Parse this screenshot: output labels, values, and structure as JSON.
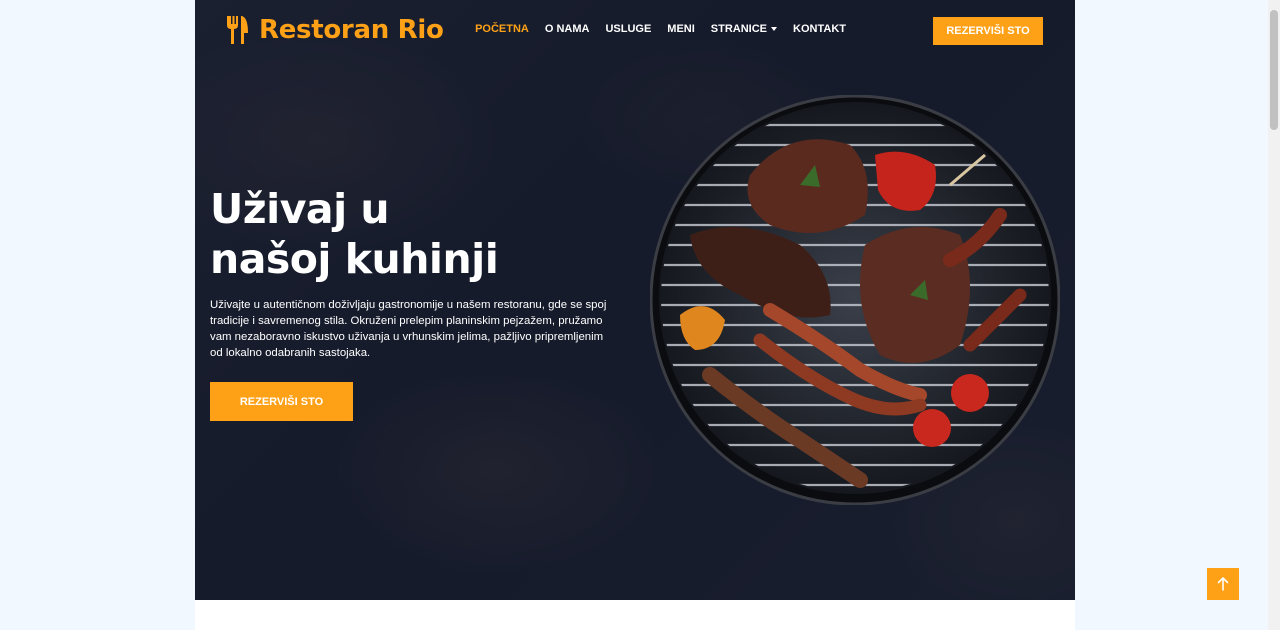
{
  "brand": {
    "name": "Restoran Rio",
    "icon": "fork-knife-icon"
  },
  "nav": {
    "items": [
      {
        "label": "POČETNA",
        "active": true
      },
      {
        "label": "O NAMA"
      },
      {
        "label": "USLUGE"
      },
      {
        "label": "MENI"
      },
      {
        "label": "STRANICE",
        "dropdown": true
      },
      {
        "label": "KONTAKT"
      }
    ],
    "cta": "REZERVIŠI STO"
  },
  "hero": {
    "title_line1": "Uživaj u",
    "title_line2": "našoj kuhinji",
    "text": "Uživajte u autentičnom doživljaju gastronomije u našem restoranu, gde se spoj tradicije i savremenog stila. Okruženi prelepim planinskim pejzažem, pružamo vam nezaboravno iskustvo uživanja u vrhunskim jelima, pažljivo pripremljenim od lokalno odabranih sastojaka.",
    "cta": "REZERVIŠI STO"
  },
  "colors": {
    "accent": "#fea116",
    "dark": "#0f172b",
    "white": "#ffffff"
  },
  "icons": {
    "back_to_top": "arrow-up-icon",
    "dropdown": "caret-down-icon",
    "grill": "grill-image"
  }
}
